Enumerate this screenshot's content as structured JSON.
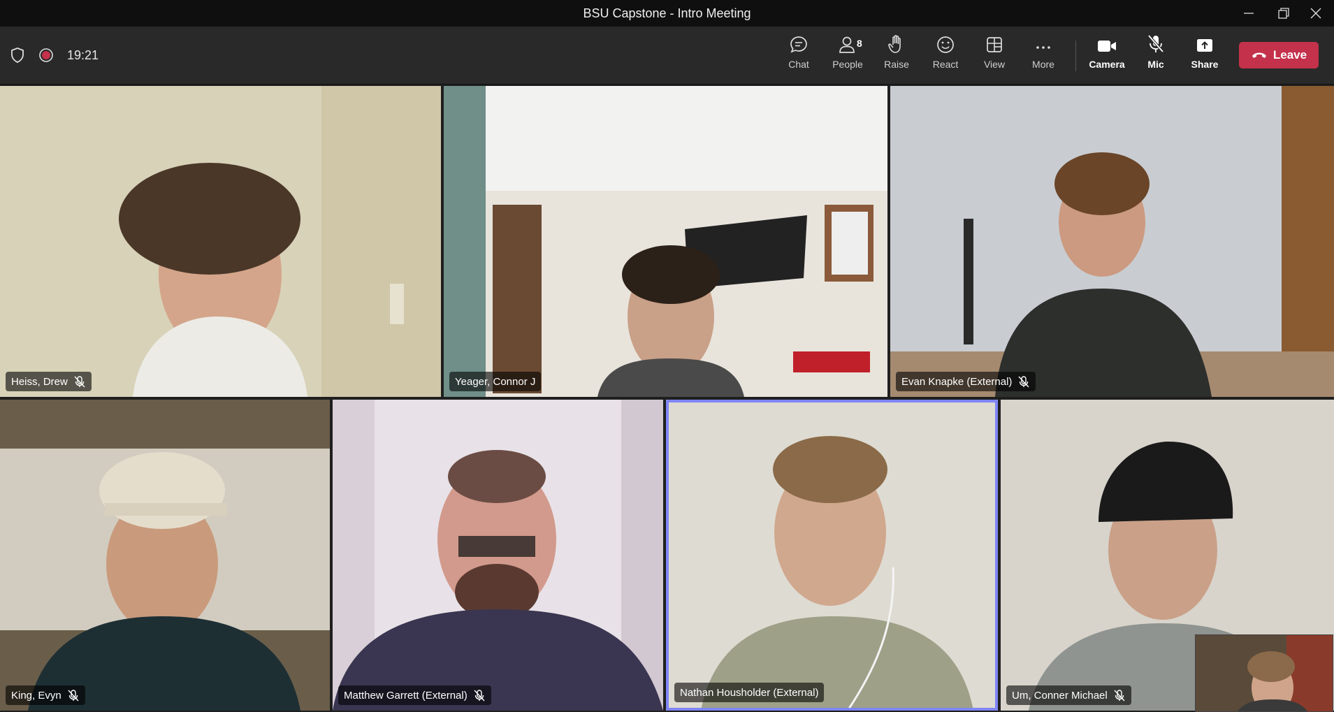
{
  "window": {
    "title": "BSU Capstone - Intro Meeting"
  },
  "toolbar": {
    "timer": "19:21",
    "buttons": {
      "chat": "Chat",
      "people": "People",
      "people_count": "8",
      "raise": "Raise",
      "react": "React",
      "view": "View",
      "more": "More",
      "camera": "Camera",
      "mic": "Mic",
      "share": "Share",
      "leave": "Leave"
    }
  },
  "participants": [
    {
      "name": "Heiss, Drew",
      "muted": true
    },
    {
      "name": "Yeager, Connor J",
      "muted": false
    },
    {
      "name": "Evan Knapke (External)",
      "muted": true
    },
    {
      "name": "King, Evyn",
      "muted": true
    },
    {
      "name": "Matthew Garrett (External)",
      "muted": true
    },
    {
      "name": "Nathan Housholder (External)",
      "muted": false,
      "speaking": true
    },
    {
      "name": "Um, Conner Michael",
      "muted": true
    }
  ],
  "colors": {
    "leave": "#c4314b",
    "speaking_border": "#7f85f5",
    "recording": "#c4314b"
  }
}
